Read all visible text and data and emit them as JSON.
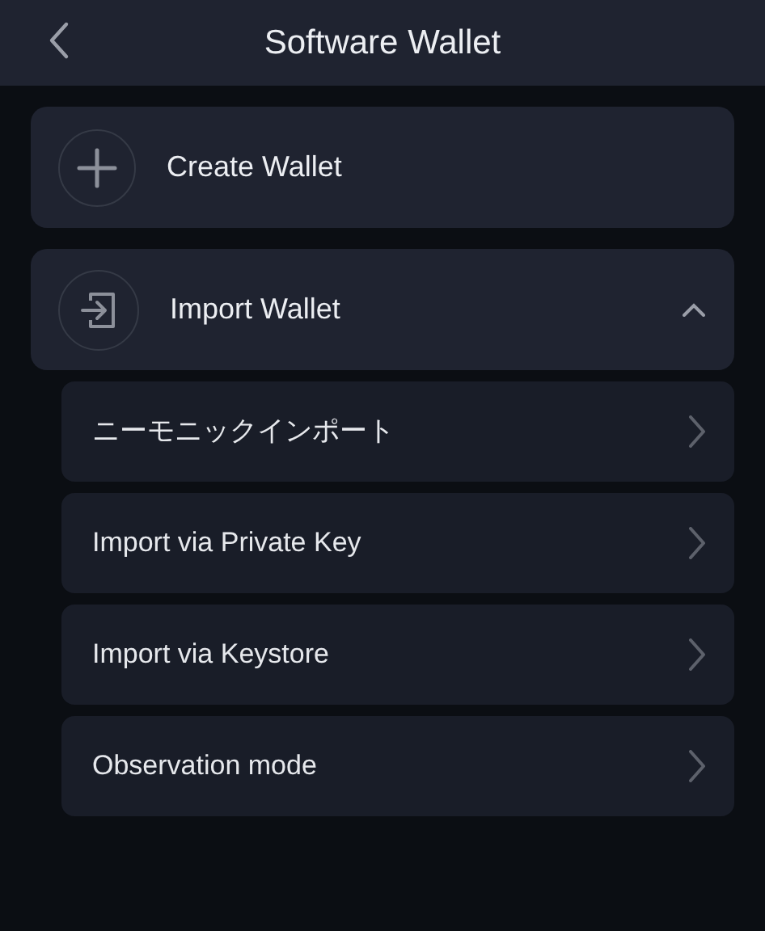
{
  "header": {
    "title": "Software Wallet"
  },
  "sections": [
    {
      "label": "Create Wallet",
      "kind": "create"
    },
    {
      "label": "Import Wallet",
      "kind": "import",
      "expanded": true,
      "children": [
        {
          "label": "ニーモニックインポート"
        },
        {
          "label": "Import via Private Key"
        },
        {
          "label": "Import via Keystore"
        },
        {
          "label": "Observation mode"
        }
      ]
    }
  ]
}
